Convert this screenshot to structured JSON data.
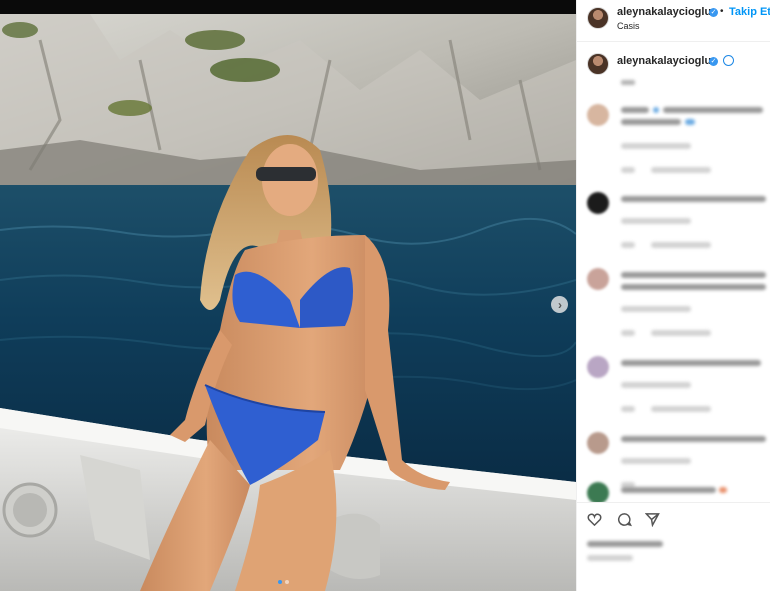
{
  "post": {
    "username": "aleynakalaycioglu",
    "follow_label": "Takip Et",
    "separator": "•",
    "location": "Casis",
    "image_alt": "Woman in blue bikini sitting on boat railing in front of sea cliffs",
    "carousel_dots": 2,
    "active_dot": 0
  },
  "icons": {
    "verified": "verified-badge-icon",
    "next": "chevron-right-icon",
    "like": "heart-icon",
    "comment": "comment-icon",
    "share": "share-icon"
  },
  "colors": {
    "accent": "#0095f6",
    "verified": "#3897f0",
    "text": "#262626"
  }
}
